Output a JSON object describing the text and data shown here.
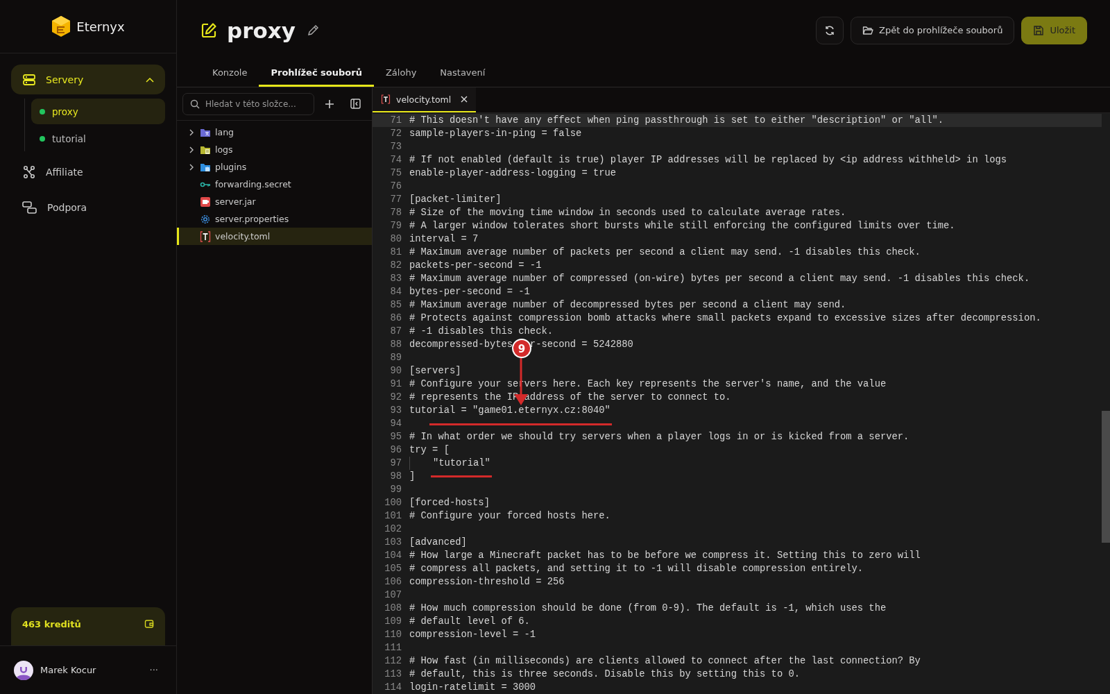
{
  "sidebar": {
    "brand": "Eternyx",
    "nav": [
      {
        "label": "Servery",
        "kind": "group",
        "selected": true,
        "expanded": true,
        "children": [
          {
            "label": "proxy",
            "selected": true,
            "color": "#22c55e"
          },
          {
            "label": "tutorial",
            "selected": false,
            "color": "#22c55e"
          }
        ]
      },
      {
        "label": "Affiliate",
        "kind": "affiliate",
        "selected": false
      },
      {
        "label": "Podpora",
        "kind": "support",
        "selected": false
      }
    ],
    "credits": {
      "text": "463 kreditů"
    },
    "user": {
      "name": "Marek Kocur",
      "menu": "···"
    }
  },
  "header": {
    "title": "proxy",
    "back_button": "Zpět do prohlížeče souborů",
    "save_button": "Uložit"
  },
  "tabs": [
    {
      "label": "Konzole",
      "selected": false
    },
    {
      "label": "Prohlížeč souborů",
      "selected": true
    },
    {
      "label": "Zálohy",
      "selected": false
    },
    {
      "label": "Nastavení",
      "selected": false
    }
  ],
  "file_tree": {
    "search": {
      "placeholder": "Hledat v této složce..."
    },
    "items": [
      {
        "name": "lang",
        "kind": "lang",
        "expanded": false,
        "selected": false
      },
      {
        "name": "logs",
        "kind": "logs",
        "expanded": false,
        "selected": false
      },
      {
        "name": "plugins",
        "kind": "plugins",
        "expanded": false,
        "selected": false
      },
      {
        "name": "forwarding.secret",
        "kind": "key",
        "selected": false
      },
      {
        "name": "server.jar",
        "kind": "jar",
        "selected": false
      },
      {
        "name": "server.properties",
        "kind": "config",
        "selected": false
      },
      {
        "name": "velocity.toml",
        "kind": "toml",
        "selected": true
      }
    ]
  },
  "editor": {
    "tabs": [
      {
        "label": "velocity.toml",
        "selected": true
      }
    ],
    "lines": [
      {
        "n": "71",
        "text": "# This doesn't have any effect when ping passthrough is set to either \"description\" or \"all\".",
        "current": true
      },
      {
        "n": "72",
        "text": "sample-players-in-ping = false",
        "current": false
      },
      {
        "n": "73",
        "current": false
      },
      {
        "n": "74",
        "text": "# If not enabled (default is true) player IP addresses will be replaced by <ip address withheld> in logs",
        "current": false
      },
      {
        "n": "75",
        "text": "enable-player-address-logging = true",
        "current": false
      },
      {
        "n": "76",
        "current": false
      },
      {
        "n": "77",
        "text": "[packet-limiter]",
        "current": false
      },
      {
        "n": "78",
        "text": "# Size of the moving time window in seconds used to calculate average rates.",
        "current": false
      },
      {
        "n": "79",
        "text": "# A larger window tolerates short bursts while still enforcing the configured limits over time.",
        "current": false
      },
      {
        "n": "80",
        "text": "interval = 7",
        "current": false
      },
      {
        "n": "81",
        "text": "# Maximum average number of packets per second a client may send. -1 disables this check.",
        "current": false
      },
      {
        "n": "82",
        "text": "packets-per-second = -1",
        "current": false
      },
      {
        "n": "83",
        "text": "# Maximum average number of compressed (on-wire) bytes per second a client may send. -1 disables this check.",
        "current": false
      },
      {
        "n": "84",
        "text": "bytes-per-second = -1",
        "current": false
      },
      {
        "n": "85",
        "text": "# Maximum average number of decompressed bytes per second a client may send.",
        "current": false
      },
      {
        "n": "86",
        "text": "# Protects against compression bomb attacks where small packets expand to excessive sizes after decompression.",
        "current": false
      },
      {
        "n": "87",
        "text": "# -1 disables this check.",
        "current": false
      },
      {
        "n": "88",
        "text": "decompressed-bytes",
        "text_after": "r-second = 5242880",
        "current": false
      },
      {
        "n": "89",
        "current": false
      },
      {
        "n": "90",
        "text": "[servers]",
        "current": false
      },
      {
        "n": "91",
        "text": "# Configure your servers here. Each key represents the server's name, and the value",
        "current": false
      },
      {
        "n": "92",
        "text": "# represents the IP address of the server to connect to.",
        "current": false
      },
      {
        "n": "93",
        "text": "tutorial = \"game01.eternyx.cz:8040\"",
        "current": false
      },
      {
        "n": "94",
        "current": false
      },
      {
        "n": "95",
        "text": "# In what order we should try servers when a player logs in or is kicked from a server.",
        "current": false
      },
      {
        "n": "96",
        "text": "try = [",
        "current": false
      },
      {
        "n": "97",
        "text": "\"tutorial\"",
        "indented": true,
        "current": false
      },
      {
        "n": "98",
        "text": "]",
        "current": false
      },
      {
        "n": "99",
        "current": false
      },
      {
        "n": "100",
        "text": "[forced-hosts]",
        "current": false
      },
      {
        "n": "101",
        "text": "# Configure your forced hosts here.",
        "current": false
      },
      {
        "n": "102",
        "current": false
      },
      {
        "n": "103",
        "text": "[advanced]",
        "current": false
      },
      {
        "n": "104",
        "text": "# How large a Minecraft packet has to be before we compress it. Setting this to zero will",
        "current": false
      },
      {
        "n": "105",
        "text": "# compress all packets, and setting it to -1 will disable compression entirely.",
        "current": false
      },
      {
        "n": "106",
        "text": "compression-threshold = 256",
        "current": false
      },
      {
        "n": "107",
        "current": false
      },
      {
        "n": "108",
        "text": "# How much compression should be done (from 0-9). The default is -1, which uses the",
        "current": false
      },
      {
        "n": "109",
        "text": "# default level of 6.",
        "current": false
      },
      {
        "n": "110",
        "text": "compression-level = -1",
        "current": false
      },
      {
        "n": "111",
        "current": false
      },
      {
        "n": "112",
        "text": "# How fast (in milliseconds) are clients allowed to connect after the last connection? By",
        "current": false
      },
      {
        "n": "113",
        "text": "# default, this is three seconds. Disable this by setting this to 0.",
        "current": false
      },
      {
        "n": "114",
        "text": "login-ratelimit = 3000",
        "current": false
      }
    ]
  },
  "annotation": {
    "label": "9"
  }
}
